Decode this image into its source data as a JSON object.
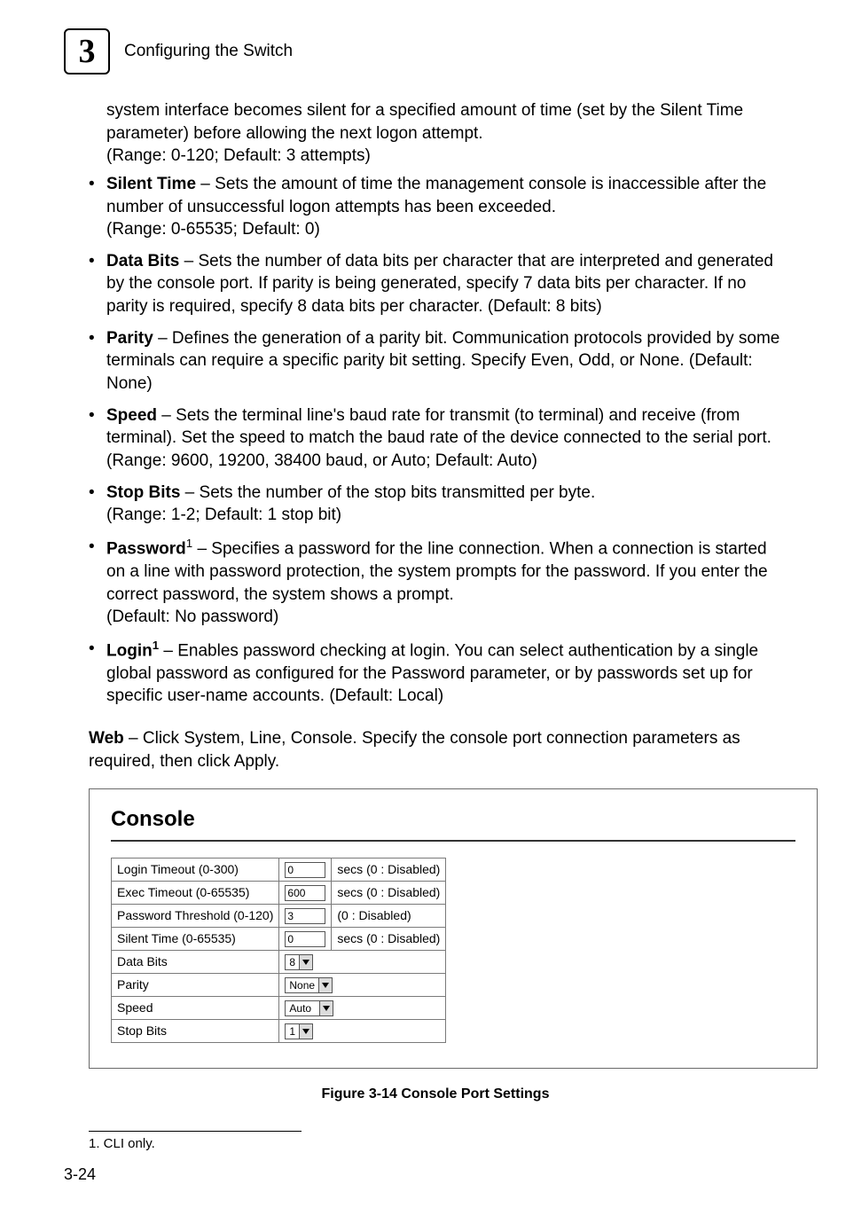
{
  "header": {
    "chapter_number": "3",
    "title": "Configuring the Switch"
  },
  "intro": {
    "continuation": "system interface becomes silent for a specified amount of time (set by the Silent Time parameter) before allowing the next logon attempt.",
    "range_default": "(Range: 0-120; Default: 3 attempts)"
  },
  "bullets": {
    "silent_time": {
      "label": "Silent Time",
      "text": " – Sets the amount of time the management console is inaccessible after the number of unsuccessful logon attempts has been exceeded.",
      "range": "(Range: 0-65535; Default: 0)"
    },
    "data_bits": {
      "label": "Data Bits",
      "text": " – Sets the number of data bits per character that are interpreted and generated by the console port. If parity is being generated, specify 7 data bits per character. If no parity is required, specify 8 data bits per character. (Default: 8 bits)"
    },
    "parity": {
      "label": "Parity",
      "text": " – Defines the generation of a parity bit. Communication protocols provided by some terminals can require a specific parity bit setting. Specify Even, Odd, or None. (Default: None)"
    },
    "speed": {
      "label": "Speed",
      "text": " – Sets the terminal line's baud rate for transmit (to terminal) and receive (from terminal). Set the speed to match the baud rate of the device connected to the serial port. (Range: 9600, 19200, 38400 baud, or Auto; Default: Auto)"
    },
    "stop_bits": {
      "label": "Stop Bits",
      "text": " – Sets the number of the stop bits transmitted per byte.",
      "range": "(Range: 1-2; Default: 1 stop bit)"
    },
    "password": {
      "label": "Password",
      "sup": "1",
      "text": " – Specifies a password for the line connection. When a connection is started on a line with password protection, the system prompts for the password. If you enter the correct password, the system shows a prompt.",
      "default": "(Default: No password)"
    },
    "login": {
      "label": "Login",
      "sup": "1",
      "text": " – Enables password checking at login. You can select authentication by a single global password as configured for the Password parameter, or by passwords set up for specific user-name accounts. (Default: Local)"
    }
  },
  "web_para": {
    "label": "Web",
    "text": " – Click System, Line, Console. Specify the console port connection parameters as required, then click Apply."
  },
  "figure": {
    "title": "Console",
    "rows": {
      "login_timeout": {
        "label": "Login Timeout (0-300)",
        "value": "0",
        "hint": "secs (0 : Disabled)"
      },
      "exec_timeout": {
        "label": "Exec Timeout (0-65535)",
        "value": "600",
        "hint": "secs (0 : Disabled)"
      },
      "pwd_threshold": {
        "label": "Password Threshold (0-120)",
        "value": "3",
        "hint": "(0 : Disabled)"
      },
      "silent_time": {
        "label": "Silent Time (0-65535)",
        "value": "0",
        "hint": "secs (0 : Disabled)"
      },
      "data_bits": {
        "label": "Data Bits",
        "value": "8"
      },
      "parity": {
        "label": "Parity",
        "value": "None"
      },
      "speed": {
        "label": "Speed",
        "value": "Auto"
      },
      "stop_bits": {
        "label": "Stop Bits",
        "value": "1"
      }
    },
    "caption": "Figure 3-14  Console Port Settings"
  },
  "footnote": "1.  CLI only.",
  "page_number": "3-24"
}
